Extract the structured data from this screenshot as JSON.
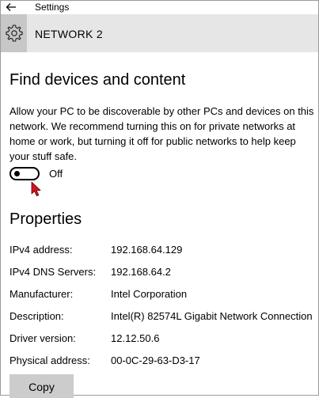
{
  "window": {
    "title": "Settings"
  },
  "header": {
    "title": "NETWORK  2"
  },
  "find_devices": {
    "heading": "Find devices and content",
    "description_lines": [
      "Allow your PC to be discoverable by other PCs and devices on this",
      "network. We recommend turning this on for private networks at",
      "home or work, but turning it off for public networks to help keep",
      "your stuff safe."
    ],
    "toggle": {
      "state_label": "Off",
      "on": false
    }
  },
  "properties": {
    "heading": "Properties",
    "rows": [
      {
        "label": "IPv4 address:",
        "value": "192.168.64.129"
      },
      {
        "label": "IPv4 DNS Servers:",
        "value": "192.168.64.2"
      },
      {
        "label": "Manufacturer:",
        "value": "Intel Corporation"
      },
      {
        "label": "Description:",
        "value": "Intel(R) 82574L Gigabit Network Connection"
      },
      {
        "label": "Driver version:",
        "value": "12.12.50.6"
      },
      {
        "label": "Physical address:",
        "value": "00-0C-29-63-D3-17"
      }
    ],
    "copy_label": "Copy"
  },
  "icons": {
    "back": "back-arrow-icon",
    "settings": "gear-icon",
    "cursor": "mouse-pointer-icon"
  },
  "colors": {
    "header_bg": "#e6e6e6",
    "gear_bg": "#c7c7c7",
    "button_bg": "#cccccc",
    "cursor_red": "#d4141e"
  }
}
